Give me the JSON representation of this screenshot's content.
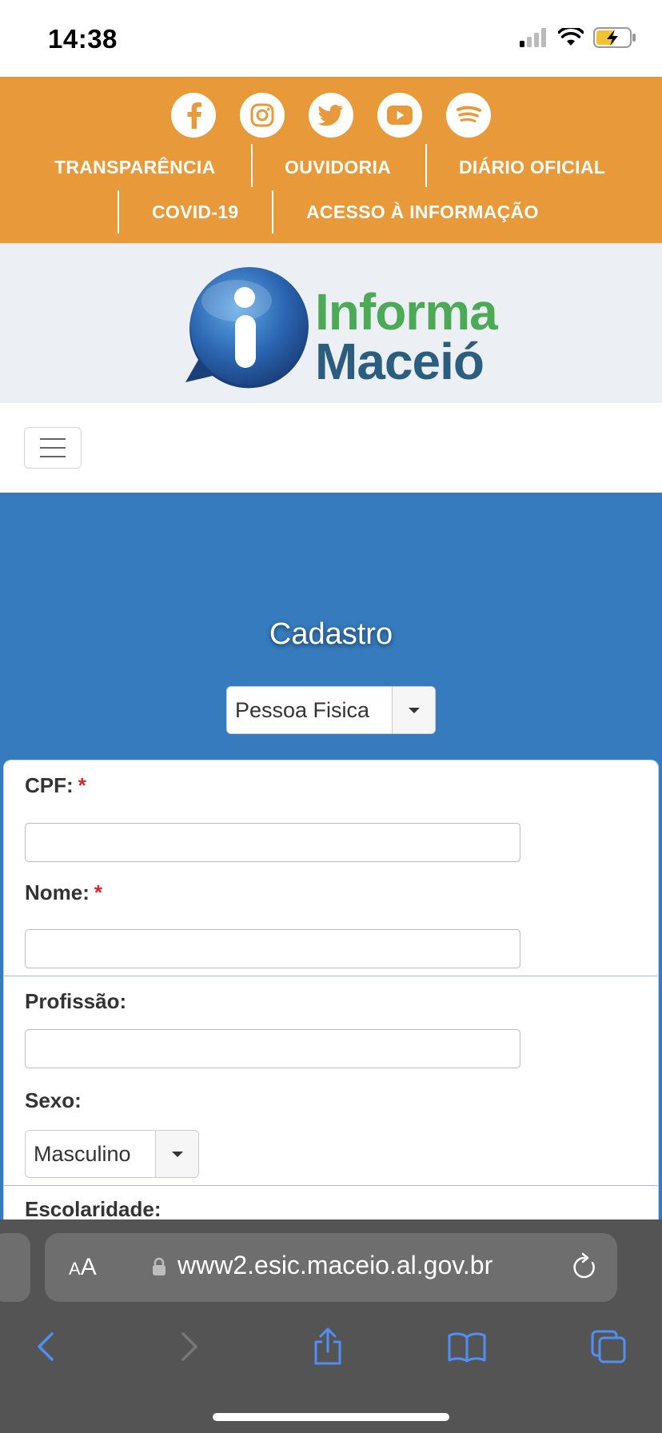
{
  "status_bar": {
    "time": "14:38"
  },
  "header": {
    "social": [
      "facebook-icon",
      "instagram-icon",
      "twitter-icon",
      "youtube-icon",
      "spotify-icon"
    ],
    "nav_row1": [
      "TRANSPARÊNCIA",
      "OUVIDORIA",
      "DIÁRIO OFICIAL"
    ],
    "nav_row2": [
      "COVID-19",
      "ACESSO À INFORMAÇÃO"
    ],
    "accent_color": "#e8993a"
  },
  "logo": {
    "line1": "Informa",
    "line2": "Maceió",
    "line1_color": "#4caa57",
    "line2_color": "#2b5e7e"
  },
  "main": {
    "title": "Cadastro",
    "person_type": {
      "selected": "Pessoa Fisica"
    },
    "background_color": "#357bbd"
  },
  "form": {
    "cpf_label": "CPF:",
    "nome_label": "Nome:",
    "required_mark": "*",
    "profissao_label": "Profissão:",
    "sexo_label": "Sexo:",
    "sexo_selected": "Masculino",
    "escolaridade_label": "Escolaridade:"
  },
  "browser": {
    "aa_small": "A",
    "aa_large": "A",
    "url": "www2.esic.maceio.al.gov.br"
  }
}
